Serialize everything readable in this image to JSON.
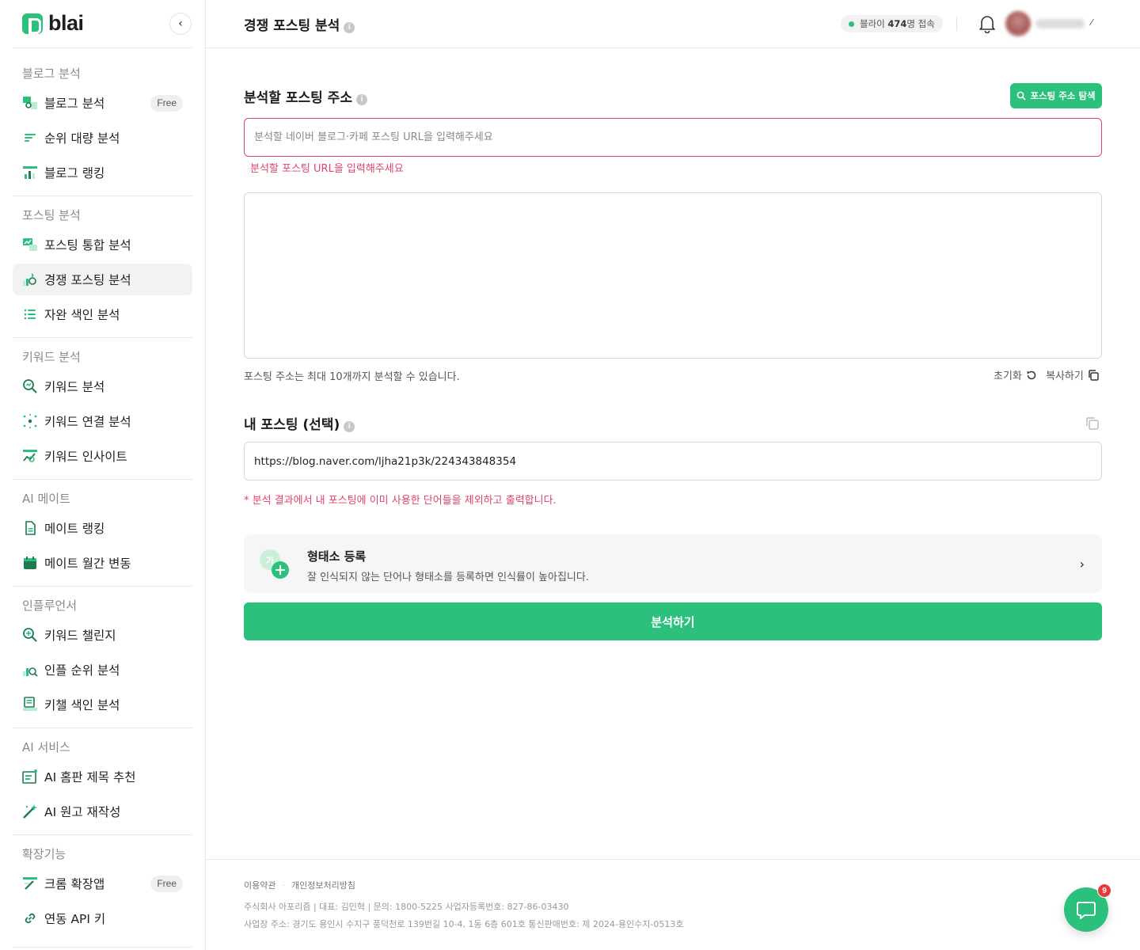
{
  "app": {
    "logo_text": "blai",
    "collapse_icon": "chevron-left-icon",
    "accent_color": "#2bc07c",
    "error_color": "#e0446a"
  },
  "sidebar": {
    "sections": [
      {
        "title": "블로그 분석",
        "items": [
          {
            "label": "블로그 분석",
            "icon": "blog-analysis-icon",
            "badge": "Free"
          },
          {
            "label": "순위 대량 분석",
            "icon": "bulk-rank-icon"
          },
          {
            "label": "블로그 랭킹",
            "icon": "blog-ranking-icon"
          }
        ]
      },
      {
        "title": "포스팅 분석",
        "items": [
          {
            "label": "포스팅 통합 분석",
            "icon": "posting-analysis-icon"
          },
          {
            "label": "경쟁 포스팅 분석",
            "icon": "competitor-analysis-icon",
            "active": true
          },
          {
            "label": "자완 색인 분석",
            "icon": "list-icon"
          }
        ]
      },
      {
        "title": "키워드 분석",
        "items": [
          {
            "label": "키워드 분석",
            "icon": "keyword-search-icon"
          },
          {
            "label": "키워드 연결 분석",
            "icon": "network-icon"
          },
          {
            "label": "키워드 인사이트",
            "icon": "insight-icon"
          }
        ]
      },
      {
        "title": "AI 메이트",
        "items": [
          {
            "label": "메이트 랭킹",
            "icon": "document-icon"
          },
          {
            "label": "메이트 월간 변동",
            "icon": "calendar-icon"
          }
        ]
      },
      {
        "title": "인플루언서",
        "items": [
          {
            "label": "키워드 챌린지",
            "icon": "zoom-plus-icon"
          },
          {
            "label": "인플 순위 분석",
            "icon": "rank-search-icon"
          },
          {
            "label": "키챌 색인 분석",
            "icon": "index-icon"
          }
        ]
      },
      {
        "title": "AI 서비스",
        "items": [
          {
            "label": "AI 홈판 제목 추천",
            "icon": "title-recommend-icon"
          },
          {
            "label": "AI 원고 재작성",
            "icon": "magic-wand-icon"
          }
        ]
      },
      {
        "title": "확장기능",
        "items": [
          {
            "label": "크롬 확장앱",
            "icon": "extension-icon",
            "badge": "Free"
          },
          {
            "label": "연동 API 키",
            "icon": "link-icon"
          }
        ]
      }
    ]
  },
  "header": {
    "title": "경쟁 포스팅 분석",
    "info_icon": "info-icon",
    "online_prefix": "블라이",
    "online_count": "474",
    "online_suffix": "명 접속",
    "bell_icon": "bell-icon",
    "avatar_icon": "avatar"
  },
  "main": {
    "url_section_title": "분석할 포스팅 주소",
    "explore_button_label": "포스팅 주소 탐색",
    "url_input_placeholder": "분석할 네이버 블로그·카페 포스팅 URL을 입력해주세요",
    "url_input_value": "",
    "url_error": "분석할 포스팅 URL을 입력해주세요",
    "url_list_value": "",
    "helper_text": "포스팅 주소는 최대 10개까지 분석할 수 있습니다.",
    "reset_label": "초기화",
    "copy_label": "복사하기",
    "my_posting_title": "내 포스팅 (선택)",
    "my_posting_value": "https://blog.naver.com/ljha21p3k/224343848354",
    "my_posting_note": "* 분석 결과에서 내 포스팅에 이미 사용한 단어들을 제외하고 출력합니다.",
    "morph_title": "형태소 등록",
    "morph_desc": "잘 인식되지 않는 단어나 형태소를 등록하면 인식률이 높아집니다.",
    "analyze_button_label": "분석하기"
  },
  "footer": {
    "link_terms": "이용약관",
    "link_privacy": "개인정보처리방침",
    "company_line": "주식회사 아포리즘 | 대표: 김민혁 | 문의: 1800-5225 사업자등록번호: 827-86-03430",
    "address_line": "사업장 주소: 경기도 용인시 수지구 풍덕천로 139번길 10-4, 1동 6층 601호 통신판매번호: 제 2024-용인수지-0513호"
  },
  "chat": {
    "icon": "chat-icon",
    "badge_count": "9"
  }
}
